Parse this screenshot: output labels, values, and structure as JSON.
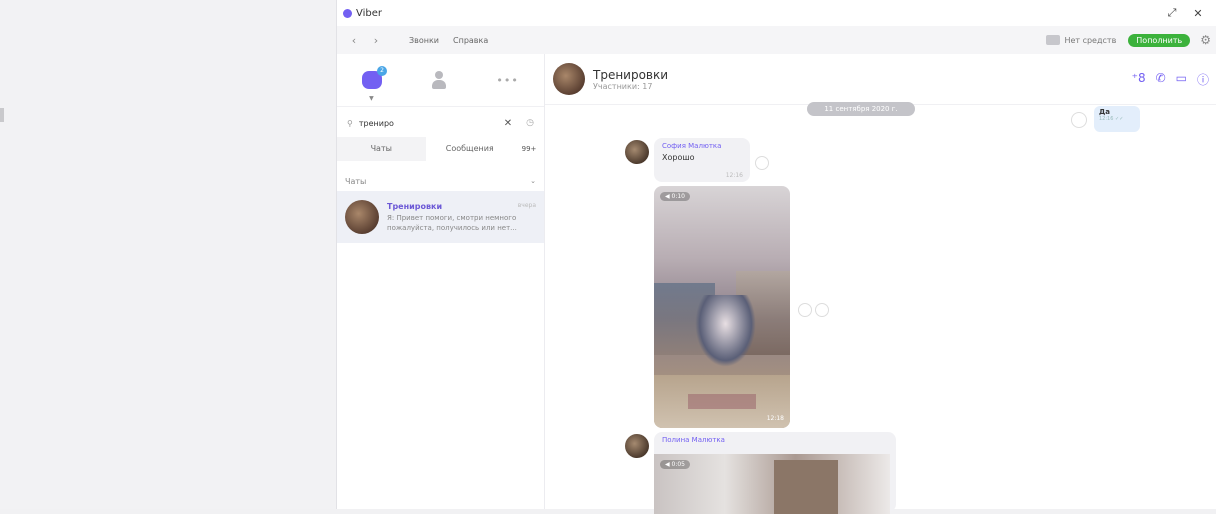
{
  "window": {
    "title": "Viber",
    "controls": {
      "restore": "⤢",
      "close": "✕"
    }
  },
  "menubar": {
    "back": "‹",
    "forward": "›",
    "items": [
      "Звонки",
      "Справка"
    ],
    "credit_label": "Нет средств",
    "topup_label": "Пополнить"
  },
  "sidebar": {
    "chat_badge": "2",
    "more": "•••",
    "search": {
      "value": "трениро"
    },
    "tabs": [
      {
        "label": "Чаты"
      },
      {
        "label": "Сообщения"
      }
    ],
    "tab_count": "99+",
    "section_label": "Чаты",
    "results": [
      {
        "name": "Тренировки",
        "time": "вчера",
        "preview": "Я: Привет помоги, смотри немного\nпожалуйста, получилось или нет..."
      }
    ]
  },
  "conversation": {
    "title": "Тренировки",
    "subtitle": "Участники: 17",
    "date": "11 сентября 2020 г.",
    "outgoing": {
      "text": "Да",
      "meta": "12:16 ✓✓"
    },
    "messages": [
      {
        "sender": "София Малютка",
        "text": "Хорошо",
        "time": "12:16"
      },
      {
        "video_duration": "◀ 0:10",
        "video_time": "12:18"
      },
      {
        "sender": "Полина Малютка",
        "video_duration": "◀ 0:05"
      }
    ]
  },
  "colors": {
    "accent": "#7360f2",
    "topup": "#3cb23c",
    "date_pill": "#c4c4c9"
  }
}
